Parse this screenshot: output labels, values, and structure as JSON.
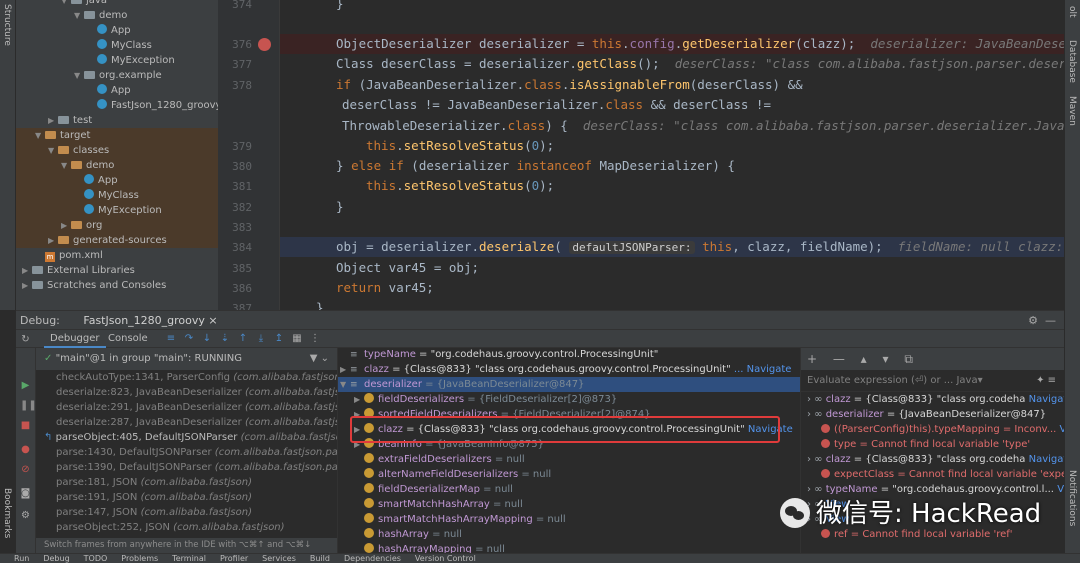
{
  "left_strip": {
    "label": "Structure"
  },
  "right_strip": {
    "labels": [
      "Notifications",
      "Maven",
      "Database",
      "olt"
    ]
  },
  "left_bottom_label": "Bookmarks",
  "project_tree": [
    {
      "label": "java",
      "icon": "folder-icon",
      "depth": 2,
      "expanded": true
    },
    {
      "label": "demo",
      "icon": "folder-icon",
      "depth": 3,
      "expanded": true
    },
    {
      "label": "App",
      "icon": "class-icon",
      "depth": 4
    },
    {
      "label": "MyClass",
      "icon": "class-icon",
      "depth": 4
    },
    {
      "label": "MyException",
      "icon": "class-icon",
      "depth": 4
    },
    {
      "label": "org.example",
      "icon": "folder-icon",
      "depth": 3,
      "expanded": true
    },
    {
      "label": "App",
      "icon": "class-icon",
      "depth": 4
    },
    {
      "label": "FastJson_1280_groovy",
      "icon": "class-icon",
      "depth": 4
    },
    {
      "label": "test",
      "icon": "folder-icon",
      "depth": 1,
      "expanded": false
    },
    {
      "label": "target",
      "icon": "folder-orange-icon",
      "depth": 0,
      "expanded": true
    },
    {
      "label": "classes",
      "icon": "folder-orange-icon",
      "depth": 1,
      "expanded": true
    },
    {
      "label": "demo",
      "icon": "folder-orange-icon",
      "depth": 2,
      "expanded": true
    },
    {
      "label": "App",
      "icon": "class-icon",
      "depth": 3
    },
    {
      "label": "MyClass",
      "icon": "class-icon",
      "depth": 3
    },
    {
      "label": "MyException",
      "icon": "class-icon",
      "depth": 3
    },
    {
      "label": "org",
      "icon": "folder-orange-icon",
      "depth": 2,
      "expanded": false
    },
    {
      "label": "generated-sources",
      "icon": "folder-orange-icon",
      "depth": 1,
      "expanded": false
    },
    {
      "label": "pom.xml",
      "icon": "maven-icon",
      "depth": 0
    },
    {
      "label": "External Libraries",
      "icon": "library-icon",
      "depth": -1,
      "expanded": false
    },
    {
      "label": "Scratches and Consoles",
      "icon": "scratch-icon",
      "depth": -1,
      "expanded": false
    }
  ],
  "editor": {
    "line_numbers": [
      "374",
      "",
      "376",
      "377",
      "378",
      "",
      "",
      "379",
      "380",
      "381",
      "382",
      "383",
      "384",
      "385",
      "386",
      "387"
    ],
    "lines": {
      "l376": {
        "type": "ObjectDeserializer",
        "var": "deserializer",
        "eq": "=",
        "this": "this",
        "dot1": ".",
        "config": "config",
        "dot2": ".",
        "call": "getDeserializer",
        "args": "(clazz);",
        "hint": "deserializer: JavaBeanDeserializer"
      },
      "l377": {
        "type": "Class",
        "rest": "deserClass = deserializer.",
        "call": "getClass",
        "args": "();",
        "hint": "deserClass: \"class com.alibaba.fastjson.parser.deser"
      },
      "l378": {
        "kw": "if",
        "open": "(",
        "cls": "JavaBeanDeserializer",
        "dotcls": ".",
        "clskw": "class",
        "dot": ".",
        "call": "isAssignableFrom",
        "args": "(deserClass) &&"
      },
      "l378b": {
        "a": "deserClass != ",
        "cls": "JavaBeanDeserializer",
        "dot": ".",
        "clskw": "class",
        "b": " && deserClass !="
      },
      "l378c": {
        "cls": "ThrowableDeserializer",
        "dot": ".",
        "clskw": "class",
        "b": ") {",
        "hint": "deserClass: \"class com.alibaba.fastjson.parser.deserializer.Java"
      },
      "l379": {
        "this": "this",
        "dot": ".",
        "call": "setResolveStatus",
        "open": "(",
        "num": "0",
        "close": ");"
      },
      "l380": {
        "a": "} ",
        "kw1": "else",
        "sp": " ",
        "kw2": "if",
        "b": " (deserializer ",
        "kw3": "instanceof",
        "cls": " MapDeserializer",
        "c": ") {"
      },
      "l381": {
        "this": "this",
        "dot": ".",
        "call": "setResolveStatus",
        "open": "(",
        "num": "0",
        "close": ");"
      },
      "l382": {
        "a": "}"
      },
      "l384": {
        "a": "obj = deserializer.",
        "call": "deserialze",
        "open": "(",
        "pill": "defaultJSONParser:",
        "this": " this",
        "b": ", clazz, fieldName);",
        "hint": "fieldName: null   clazz:"
      },
      "l385": {
        "type": "Object",
        "b": " var45 = obj;"
      },
      "l386": {
        "kw": "return",
        "b": " var45;"
      },
      "l374": {
        "a": "}"
      },
      "l387": {
        "a": "}"
      }
    }
  },
  "debug": {
    "title": "Debug:",
    "tab": "FastJson_1280_groovy",
    "tabs": [
      "Debugger",
      "Console"
    ],
    "thread": "\"main\"@1 in group \"main\": RUNNING",
    "frames": [
      {
        "method": "checkAutoType:1341, ParserConfig",
        "pkg": "(com.alibaba.fastjson.par"
      },
      {
        "method": "deserialze:823, JavaBeanDeserializer",
        "pkg": "(com.alibaba.fastjson.p"
      },
      {
        "method": "deserialze:291, JavaBeanDeserializer",
        "pkg": "(com.alibaba.fastjson.p"
      },
      {
        "method": "deserialze:287, JavaBeanDeserializer",
        "pkg": "(com.alibaba.fastjson.p"
      },
      {
        "method": "parseObject:405, DefaultJSONParser",
        "pkg": "(com.alibaba.fastjson.p",
        "current": true
      },
      {
        "method": "parse:1430, DefaultJSONParser",
        "pkg": "(com.alibaba.fastjson.parser"
      },
      {
        "method": "parse:1390, DefaultJSONParser",
        "pkg": "(com.alibaba.fastjson.parser"
      },
      {
        "method": "parse:181, JSON",
        "pkg": "(com.alibaba.fastjson)"
      },
      {
        "method": "parse:191, JSON",
        "pkg": "(com.alibaba.fastjson)"
      },
      {
        "method": "parse:147, JSON",
        "pkg": "(com.alibaba.fastjson)"
      },
      {
        "method": "parseObject:252, JSON",
        "pkg": "(com.alibaba.fastjson)"
      }
    ],
    "switch_tip": "Switch frames from anywhere in the IDE with ⌥⌘↑ and ⌥⌘↓",
    "variables": [
      {
        "name": "typeName",
        "value": "= \"org.codehaus.groovy.control.ProcessingUnit\"",
        "depth": 0,
        "kind": "eq"
      },
      {
        "name": "clazz",
        "value": "= {Class@833} \"class org.codehaus.groovy.control.ProcessingUnit\"",
        "nav": "... Navigate",
        "depth": 0,
        "kind": "eq"
      },
      {
        "name": "deserializer",
        "value": "= {JavaBeanDeserializer@847}",
        "depth": 0,
        "kind": "eq",
        "selected": true
      },
      {
        "name": "fieldDeserializers",
        "value": "= {FieldDeserializer[2]@873}",
        "depth": 1,
        "kind": "field"
      },
      {
        "name": "sortedFieldDeserializers",
        "value": "= {FieldDeserializer[2]@874}",
        "depth": 1,
        "kind": "field"
      },
      {
        "name": "clazz",
        "value": "= {Class@833} \"class org.codehaus.groovy.control.ProcessingUnit\"",
        "nav": "Navigate",
        "depth": 1,
        "kind": "field"
      },
      {
        "name": "beanInfo",
        "value": "= {JavaBeanInfo@875}",
        "depth": 1,
        "kind": "field"
      },
      {
        "name": "extraFieldDeserializers",
        "value": "= null",
        "depth": 1,
        "kind": "field"
      },
      {
        "name": "alterNameFieldDeserializers",
        "value": "= null",
        "depth": 1,
        "kind": "field"
      },
      {
        "name": "fieldDeserializerMap",
        "value": "= null",
        "depth": 1,
        "kind": "field"
      },
      {
        "name": "smartMatchHashArray",
        "value": "= null",
        "depth": 1,
        "kind": "field"
      },
      {
        "name": "smartMatchHashArrayMapping",
        "value": "= null",
        "depth": 1,
        "kind": "field"
      },
      {
        "name": "hashArray",
        "value": "= null",
        "depth": 1,
        "kind": "field"
      },
      {
        "name": "hashArrayMapping",
        "value": "= null",
        "depth": 1,
        "kind": "field"
      }
    ],
    "evaluate_placeholder": "Evaluate expression (⏎) or ... Java▾",
    "watches": [
      {
        "name": "clazz",
        "value": "= {Class@833} \"class org.codeha",
        "nav": "Navigate",
        "kind": "watch"
      },
      {
        "name": "deserializer",
        "value": "= {JavaBeanDeserializer@847}",
        "kind": "watch"
      },
      {
        "name": "((ParserConfig)this).typeMapping",
        "value": "= Inconv...",
        "nav": "View",
        "kind": "error"
      },
      {
        "name": "type",
        "value": "= Cannot find local variable 'type'",
        "kind": "error"
      },
      {
        "name": "clazz",
        "value": "= {Class@833} \"class org.codeha",
        "nav": "Navigate",
        "kind": "watch"
      },
      {
        "name": "expectClass",
        "value": "= Cannot find local variable 'expectCla",
        "kind": "error"
      },
      {
        "name": "typeName",
        "value": "= \"org.codehaus.groovy.control.l...",
        "nav": "View",
        "kind": "watch"
      },
      {
        "name": "",
        "value": "",
        "nav": "View",
        "kind": "watch"
      },
      {
        "name": "",
        "value": "",
        "nav": "View",
        "kind": "watch"
      },
      {
        "name": "ref",
        "value": "= Cannot find local variable 'ref'",
        "kind": "error"
      }
    ]
  },
  "bottom_bar": [
    "Run",
    "Debug",
    "TODO",
    "Problems",
    "Terminal",
    "Profiler",
    "Services",
    "Build",
    "Dependencies",
    "Version Control"
  ],
  "watermark": "微信号: HackRead",
  "colors": {
    "accent": "#4a88c7",
    "breakpoint": "#c75450",
    "highlight_box": "#e03b3b"
  }
}
